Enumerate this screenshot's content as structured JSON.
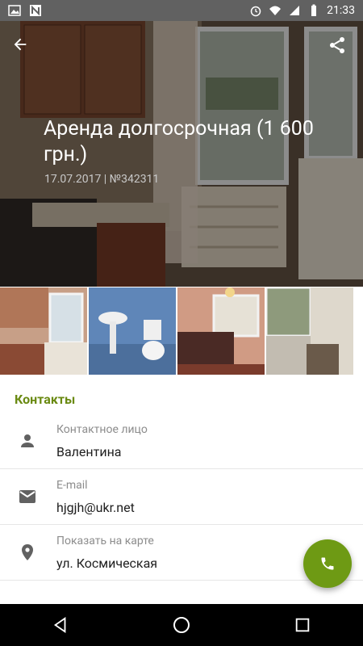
{
  "status": {
    "time": "21:33"
  },
  "listing": {
    "title": "Аренда долгосрочная (1 600 грн.)",
    "meta": "17.07.2017 | №342311"
  },
  "contacts": {
    "section_title": "Контакты",
    "items": [
      {
        "label": "Контактное лицо",
        "value": "Валентина",
        "icon": "person-icon"
      },
      {
        "label": "E-mail",
        "value": "hjgjh@ukr.net",
        "icon": "email-icon"
      },
      {
        "label": "Показать на карте",
        "value": "ул. Космическая",
        "icon": "location-pin-icon"
      }
    ]
  },
  "colors": {
    "accent": "#6a8a12",
    "fab": "#6e9a14"
  }
}
